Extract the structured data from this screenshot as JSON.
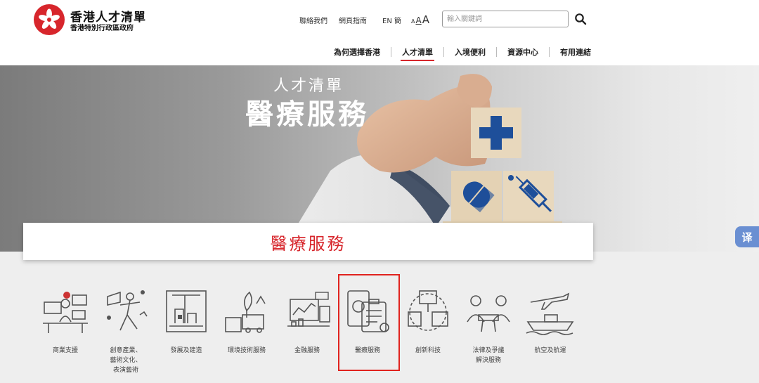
{
  "header": {
    "logo_title": "香港人才清單",
    "logo_sub": "香港特別行政區政府",
    "links": {
      "contact": "聯絡我們",
      "sitemap": "網頁指南",
      "lang": "EN 簡"
    },
    "font_sizes": [
      "A",
      "A",
      "A"
    ],
    "search_placeholder": "輸入關鍵詞"
  },
  "nav": {
    "items": [
      "為何選擇香港",
      "人才清單",
      "入境便利",
      "資源中心",
      "有用連結"
    ],
    "active_index": 1
  },
  "hero": {
    "subtitle": "人才清單",
    "title": "醫療服務"
  },
  "section": {
    "title": "醫療服務"
  },
  "translate_label": "译",
  "categories": [
    {
      "label": "商業支援",
      "icon": "business-support-icon"
    },
    {
      "label": "創意產業、\n藝術文化、\n表演藝術",
      "icon": "creative-arts-icon"
    },
    {
      "label": "發展及建造",
      "icon": "construction-icon"
    },
    {
      "label": "環境技術服務",
      "icon": "environment-icon"
    },
    {
      "label": "金融服務",
      "icon": "finance-icon"
    },
    {
      "label": "醫療服務",
      "icon": "medical-icon",
      "selected": true
    },
    {
      "label": "創新科技",
      "icon": "innovation-tech-icon"
    },
    {
      "label": "法律及爭議\n解決服務",
      "icon": "legal-icon"
    },
    {
      "label": "航空及航運",
      "icon": "aviation-shipping-icon"
    }
  ],
  "colors": {
    "brand_red": "#d7262c",
    "highlight_red": "#e0231e",
    "block_blue": "#1e4f9a"
  }
}
